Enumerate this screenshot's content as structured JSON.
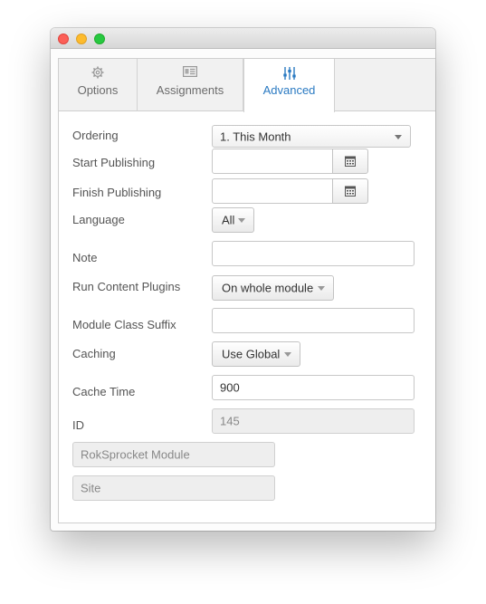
{
  "tabs": [
    {
      "label": "Options",
      "icon": "gear-icon"
    },
    {
      "label": "Assignments",
      "icon": "layout-icon"
    },
    {
      "label": "Advanced",
      "icon": "sliders-icon",
      "active": true
    }
  ],
  "fields": {
    "ordering": {
      "label": "Ordering",
      "value": "1. This Month"
    },
    "start_publishing": {
      "label": "Start Publishing",
      "value": ""
    },
    "finish_publishing": {
      "label": "Finish Publishing",
      "value": ""
    },
    "language": {
      "label": "Language",
      "value": "All"
    },
    "note": {
      "label": "Note",
      "value": ""
    },
    "run_content_plugins": {
      "label": "Run Content Plugins",
      "value": "On whole module"
    },
    "module_class_suffix": {
      "label": "Module Class Suffix",
      "value": ""
    },
    "caching": {
      "label": "Caching",
      "value": "Use Global"
    },
    "cache_time": {
      "label": "Cache Time",
      "value": "900"
    },
    "id": {
      "label": "ID",
      "value": "145"
    },
    "module_type": {
      "value": "RokSprocket Module"
    },
    "client": {
      "value": "Site"
    }
  },
  "colors": {
    "active_tab": "#2a7ac2"
  }
}
